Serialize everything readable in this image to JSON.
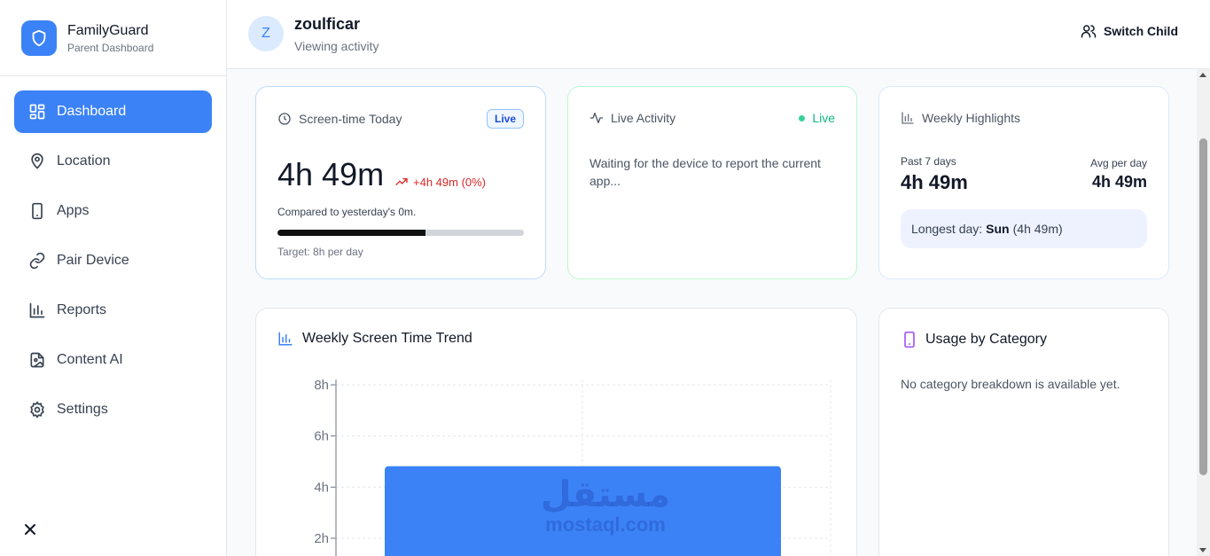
{
  "brand": {
    "name": "FamilyGuard",
    "subtitle": "Parent Dashboard"
  },
  "sidebar": {
    "items": [
      {
        "label": "Dashboard",
        "icon": "dashboard-icon",
        "active": true
      },
      {
        "label": "Location",
        "icon": "map-pin-icon"
      },
      {
        "label": "Apps",
        "icon": "smartphone-icon"
      },
      {
        "label": "Pair Device",
        "icon": "link-icon"
      },
      {
        "label": "Reports",
        "icon": "bar-chart-icon"
      },
      {
        "label": "Content AI",
        "icon": "image-scan-icon"
      },
      {
        "label": "Settings",
        "icon": "gear-icon"
      }
    ],
    "close_icon": "close-icon"
  },
  "header": {
    "avatar_letter": "Z",
    "child_name": "zoulficar",
    "subtitle": "Viewing activity",
    "switch_label": "Switch Child"
  },
  "screen_time": {
    "title": "Screen-time Today",
    "badge": "Live",
    "value": "4h 49m",
    "delta": "+4h 49m (0%)",
    "compared": "Compared to yesterday's 0m.",
    "progress": 0.6,
    "target": "Target: 8h per day"
  },
  "live_activity": {
    "title": "Live Activity",
    "status": "Live",
    "message": "Waiting for the device to report the current app..."
  },
  "weekly_highlights": {
    "title": "Weekly Highlights",
    "past_label": "Past 7 days",
    "past_value": "4h 49m",
    "avg_label": "Avg per day",
    "avg_value": "4h 49m",
    "longest_prefix": "Longest day:",
    "longest_day": "Sun",
    "longest_time": "(4h 49m)"
  },
  "trend": {
    "title": "Weekly Screen Time Trend"
  },
  "category": {
    "title": "Usage by Category",
    "empty": "No category breakdown is available yet."
  },
  "watermark": {
    "arabic": "مستقل",
    "latin": "mostaql.com"
  },
  "colors": {
    "accent": "#3b82f6",
    "live_green": "#10b981",
    "delta_red": "#dc2626"
  },
  "chart_data": {
    "type": "bar",
    "title": "Weekly Screen Time Trend",
    "yticks": [
      "2h",
      "4h",
      "6h",
      "8h"
    ],
    "ylim": [
      0,
      8
    ],
    "series": [
      {
        "values": [
          4.82
        ]
      }
    ],
    "grid": true
  }
}
